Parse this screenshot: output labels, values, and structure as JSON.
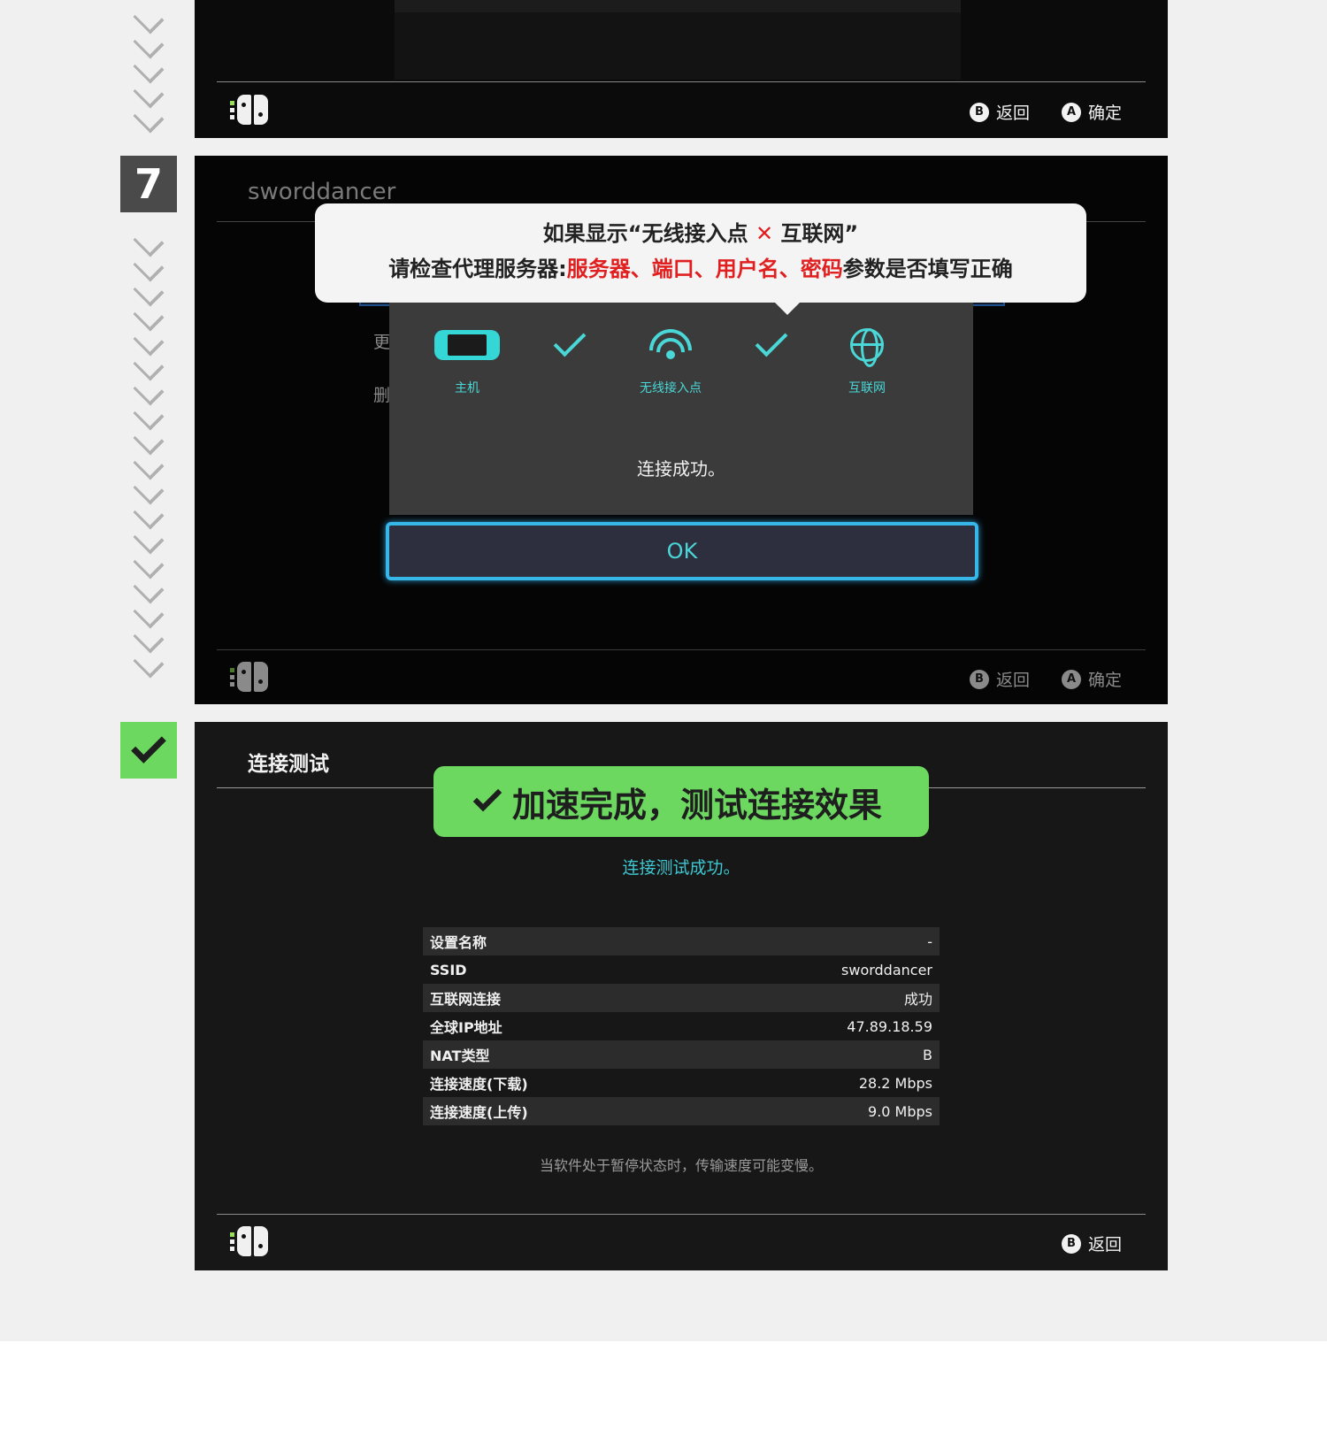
{
  "steps": {
    "step7_number": "7"
  },
  "shot1": {
    "back_label": "返回",
    "back_button": "B",
    "confirm_label": "确定",
    "confirm_button": "A"
  },
  "shot2": {
    "network_name": "sworddancer",
    "side_items": [
      "更",
      "删"
    ],
    "nodes": {
      "console": "主机",
      "access_point": "无线接入点",
      "internet": "互联网"
    },
    "message": "连接成功。",
    "ok_label": "OK",
    "back_label": "返回",
    "back_button": "B",
    "confirm_label": "确定",
    "confirm_button": "A"
  },
  "callout": {
    "line1_pre": "如果显示“无线接入点",
    "line1_x": "✕",
    "line1_post": "互联网”",
    "line2_pre": "请检查代理服务器:",
    "line2_red": "服务器、端口、用户名、密码",
    "line2_post": "参数是否填写正确"
  },
  "banner": {
    "text": "加速完成，测试连接效果"
  },
  "shot3": {
    "title": "连接测试",
    "result": "连接测试成功。",
    "rows": [
      {
        "key": "设置名称",
        "value": "-"
      },
      {
        "key": "SSID",
        "value": "sworddancer"
      },
      {
        "key": "互联网连接",
        "value": "成功"
      },
      {
        "key": "全球IP地址",
        "value": "47.89.18.59"
      },
      {
        "key": "NAT类型",
        "value": "B"
      },
      {
        "key": "连接速度(下载)",
        "value": "28.2 Mbps"
      },
      {
        "key": "连接速度(上传)",
        "value": "9.0 Mbps"
      }
    ],
    "note": "当软件处于暂停状态时，传输速度可能变慢。",
    "back_label": "返回",
    "back_button": "B"
  },
  "colors": {
    "accent_cyan": "#4ad7d7",
    "ok_border": "#37b7e8",
    "warning_red": "#e02020",
    "success_green": "#6cd860"
  }
}
